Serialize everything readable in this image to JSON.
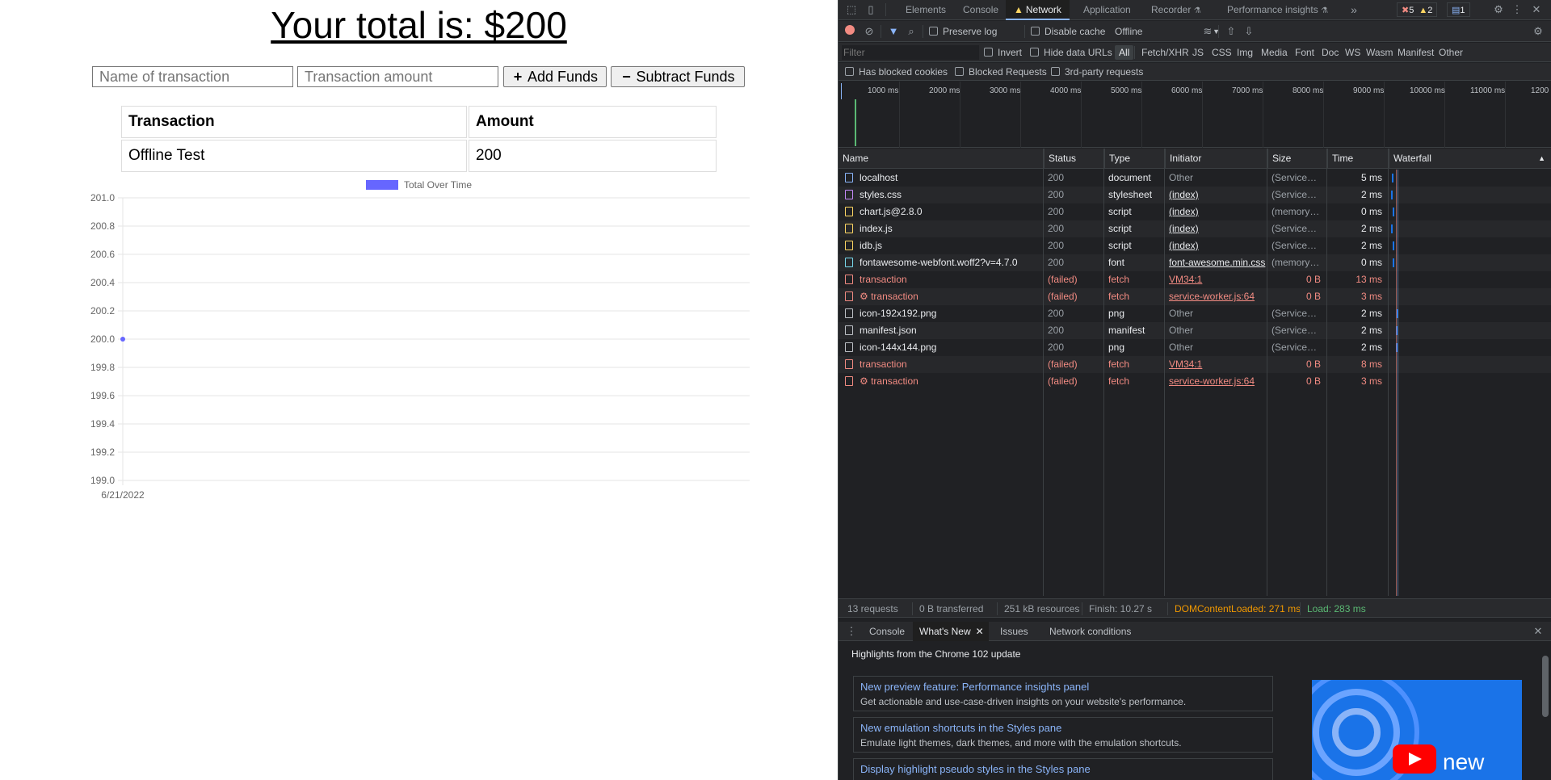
{
  "app": {
    "total_text": "Your total is: $200",
    "name_placeholder": "Name of transaction",
    "amount_placeholder": "Transaction amount",
    "add_button": "Add Funds",
    "subtract_button": "Subtract Funds",
    "table": {
      "headers": [
        "Transaction",
        "Amount"
      ],
      "rows": [
        {
          "name": "Offline Test",
          "amount": "200"
        }
      ]
    }
  },
  "chart_data": {
    "type": "line",
    "title": "",
    "legend": "Total Over Time",
    "legend_color": "#6666ff",
    "x": [
      "6/21/2022"
    ],
    "series": [
      {
        "name": "Total Over Time",
        "values": [
          200
        ]
      }
    ],
    "y_ticks": [
      "201.0",
      "200.8",
      "200.6",
      "200.4",
      "200.2",
      "200.0",
      "199.8",
      "199.6",
      "199.4",
      "199.2",
      "199.0"
    ],
    "ylim": [
      199.0,
      201.0
    ],
    "grid": true,
    "xlabel": "",
    "ylabel": ""
  },
  "devtools": {
    "tabs": [
      "Elements",
      "Console",
      "Network",
      "Application",
      "Recorder",
      "Performance insights"
    ],
    "active_tab": "Network",
    "badges": {
      "errors": "5",
      "warnings": "2",
      "messages": "1"
    },
    "toolbar": {
      "preserve_log": "Preserve log",
      "disable_cache": "Disable cache",
      "throttle": "Offline"
    },
    "filter": {
      "placeholder": "Filter",
      "invert": "Invert",
      "hide_data_urls": "Hide data URLs",
      "types": [
        "All",
        "Fetch/XHR",
        "JS",
        "CSS",
        "Img",
        "Media",
        "Font",
        "Doc",
        "WS",
        "Wasm",
        "Manifest",
        "Other"
      ]
    },
    "options": {
      "blocked_cookies": "Has blocked cookies",
      "blocked_requests": "Blocked Requests",
      "third_party": "3rd-party requests"
    },
    "timeline_ticks": [
      "1000 ms",
      "2000 ms",
      "3000 ms",
      "4000 ms",
      "5000 ms",
      "6000 ms",
      "7000 ms",
      "8000 ms",
      "9000 ms",
      "10000 ms",
      "11000 ms",
      "1200"
    ],
    "columns": [
      "Name",
      "Status",
      "Type",
      "Initiator",
      "Size",
      "Time",
      "Waterfall"
    ],
    "requests": [
      {
        "name": "localhost",
        "status": "200",
        "type": "document",
        "initiator": "Other",
        "size": "(ServiceW...",
        "time": "5 ms",
        "failed": false,
        "icon": "document-icon",
        "icon_color": "#8ab4f8"
      },
      {
        "name": "styles.css",
        "status": "200",
        "type": "stylesheet",
        "initiator": "(index)",
        "size": "(ServiceW...",
        "time": "2 ms",
        "failed": false,
        "icon": "stylesheet-icon",
        "icon_color": "#c58af9"
      },
      {
        "name": "chart.js@2.8.0",
        "status": "200",
        "type": "script",
        "initiator": "(index)",
        "size": "(memory c...",
        "time": "0 ms",
        "failed": false,
        "icon": "script-icon",
        "icon_color": "#fdd663"
      },
      {
        "name": "index.js",
        "status": "200",
        "type": "script",
        "initiator": "(index)",
        "size": "(ServiceW...",
        "time": "2 ms",
        "failed": false,
        "icon": "script-icon",
        "icon_color": "#fdd663"
      },
      {
        "name": "idb.js",
        "status": "200",
        "type": "script",
        "initiator": "(index)",
        "size": "(ServiceW...",
        "time": "2 ms",
        "failed": false,
        "icon": "script-icon",
        "icon_color": "#fdd663"
      },
      {
        "name": "fontawesome-webfont.woff2?v=4.7.0",
        "status": "200",
        "type": "font",
        "initiator": "font-awesome.min.css",
        "size": "(memory c...",
        "time": "0 ms",
        "failed": false,
        "icon": "font-icon",
        "icon_color": "#78d9ec"
      },
      {
        "name": "transaction",
        "status": "(failed)",
        "type": "fetch",
        "initiator": "VM34:1",
        "size": "0 B",
        "time": "13 ms",
        "failed": true,
        "icon": "fetch-icon",
        "icon_color": "#f28b82"
      },
      {
        "name": "⚙ transaction",
        "status": "(failed)",
        "type": "fetch",
        "initiator": "service-worker.js:64",
        "size": "0 B",
        "time": "3 ms",
        "failed": true,
        "icon": "fetch-icon",
        "icon_color": "#f28b82"
      },
      {
        "name": "icon-192x192.png",
        "status": "200",
        "type": "png",
        "initiator": "Other",
        "size": "(ServiceW...",
        "time": "2 ms",
        "failed": false,
        "icon": "image-icon",
        "icon_color": "#bdc1c6"
      },
      {
        "name": "manifest.json",
        "status": "200",
        "type": "manifest",
        "initiator": "Other",
        "size": "(ServiceW...",
        "time": "2 ms",
        "failed": false,
        "icon": "manifest-icon",
        "icon_color": "#bdc1c6"
      },
      {
        "name": "icon-144x144.png",
        "status": "200",
        "type": "png",
        "initiator": "Other",
        "size": "(ServiceW...",
        "time": "2 ms",
        "failed": false,
        "icon": "image-icon",
        "icon_color": "#bdc1c6"
      },
      {
        "name": "transaction",
        "status": "(failed)",
        "type": "fetch",
        "initiator": "VM34:1",
        "size": "0 B",
        "time": "8 ms",
        "failed": true,
        "icon": "fetch-icon",
        "icon_color": "#f28b82"
      },
      {
        "name": "⚙ transaction",
        "status": "(failed)",
        "type": "fetch",
        "initiator": "service-worker.js:64",
        "size": "0 B",
        "time": "3 ms",
        "failed": true,
        "icon": "fetch-icon",
        "icon_color": "#f28b82"
      }
    ],
    "summary": {
      "requests": "13 requests",
      "transferred": "0 B transferred",
      "resources": "251 kB resources",
      "finish": "Finish: 10.27 s",
      "dcl": "DOMContentLoaded: 271 ms",
      "load": "Load: 283 ms",
      "dcl_color": "#f29900",
      "load_color": "#5bb974"
    },
    "drawer_tabs": [
      "Console",
      "What's New",
      "Issues",
      "Network conditions"
    ],
    "drawer_active": "What's New",
    "highlights_title": "Highlights from the Chrome 102 update",
    "cards": [
      {
        "title": "New preview feature: Performance insights panel",
        "desc": "Get actionable and use-case-driven insights on your website's performance."
      },
      {
        "title": "New emulation shortcuts in the Styles pane",
        "desc": "Emulate light themes, dark themes, and more with the emulation shortcuts."
      },
      {
        "title": "Display highlight pseudo styles in the Styles pane",
        "desc": ""
      }
    ],
    "video_text": "new"
  }
}
